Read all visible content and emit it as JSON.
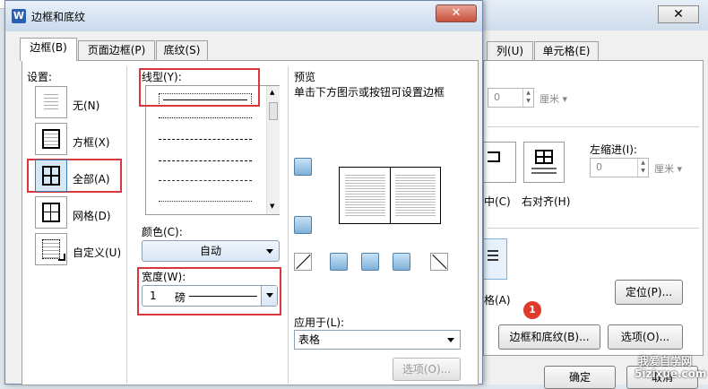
{
  "back_dialog": {
    "tabs": [
      "列(U)",
      "单元格(E)"
    ],
    "indent_value": "0",
    "indent_unit": "厘米",
    "left_indent_label": "左缩进(I):",
    "left_indent_value": "0",
    "left_indent_unit": "厘米",
    "align_partial": "中(C)",
    "align_right": "右对齐(H)",
    "wrap_partial": "格(A)",
    "position_button": "定位(P)...",
    "step_badge": "1",
    "borders_button": "边框和底纹(B)...",
    "options_button": "选项(O)...",
    "ok_button": "确定",
    "cancel_button": "取消"
  },
  "dialog": {
    "app_icon": "W",
    "title": "边框和底纹",
    "close_symbol": "✕",
    "tabs": [
      "边框(B)",
      "页面边框(P)",
      "底纹(S)"
    ],
    "settings_label": "设置:",
    "settings": [
      "无(N)",
      "方框(X)",
      "全部(A)",
      "网格(D)",
      "自定义(U)"
    ],
    "line_style_label": "线型(Y):",
    "color_label": "颜色(C):",
    "color_value": "自动",
    "width_label": "宽度(W):",
    "width_value": "1",
    "width_unit": "磅",
    "preview_label": "预览",
    "preview_hint": "单击下方图示或按钮可设置边框",
    "apply_label": "应用于(L):",
    "apply_value": "表格",
    "options_button": "选项(O)..."
  },
  "watermark": {
    "line1": "我爱自学网",
    "line2": "5izixue.com"
  },
  "colors": {
    "highlight": "#d9363e",
    "badge": "#e03a2c",
    "accent": "#2b5fb4"
  }
}
